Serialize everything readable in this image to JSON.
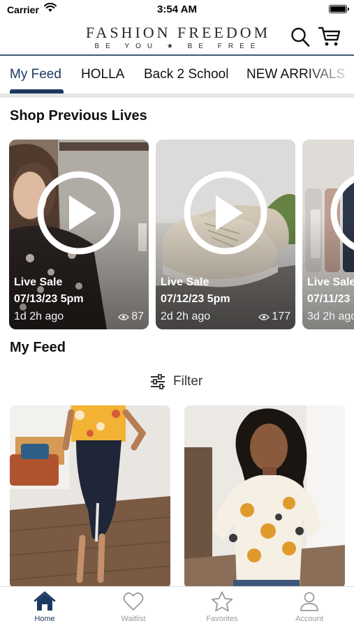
{
  "status_bar": {
    "carrier": "Carrier",
    "time": "3:54 AM"
  },
  "header": {
    "brand_name": "FASHION FREEDOM",
    "brand_tagline": "BE YOU ★ BE FREE",
    "icons": [
      "search-icon",
      "cart-icon"
    ]
  },
  "tabs": [
    {
      "label": "My Feed",
      "active": true
    },
    {
      "label": "HOLLA"
    },
    {
      "label": "Back 2 School"
    },
    {
      "label": "NEW ARRIVALS"
    }
  ],
  "shop_previous_lives": {
    "title": "Shop Previous Lives",
    "cards": [
      {
        "label": "Live Sale",
        "date": "07/13/23 5pm",
        "ago": "1d 2h ago",
        "views": "87"
      },
      {
        "label": "Live Sale",
        "date": "07/12/23 5pm",
        "ago": "2d 2h ago",
        "views": "177"
      },
      {
        "label": "Live Sale",
        "date": "07/11/23",
        "ago": "3d 2h ago",
        "views": ""
      }
    ]
  },
  "my_feed": {
    "title": "My Feed",
    "filter_label": "Filter"
  },
  "tab_bar": [
    {
      "label": "Home",
      "icon": "home-icon",
      "active": true
    },
    {
      "label": "Waitlist",
      "icon": "heart-icon"
    },
    {
      "label": "Favorites",
      "icon": "star-icon"
    },
    {
      "label": "Account",
      "icon": "person-icon"
    }
  ],
  "colors": {
    "accent": "#1d3a63",
    "header_rule": "#3f5a78",
    "inactive": "#9a9a9a"
  }
}
